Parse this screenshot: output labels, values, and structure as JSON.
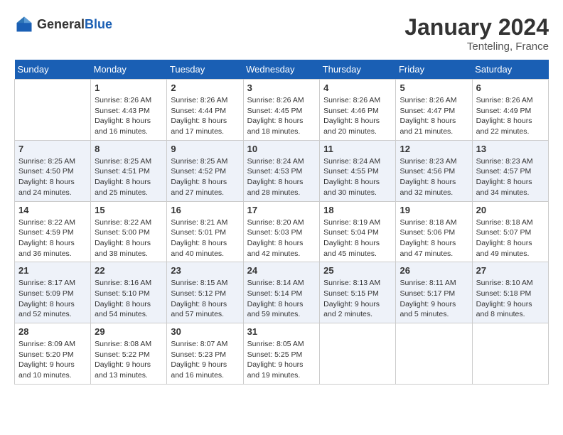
{
  "header": {
    "logo_general": "General",
    "logo_blue": "Blue",
    "month": "January 2024",
    "location": "Tenteling, France"
  },
  "weekdays": [
    "Sunday",
    "Monday",
    "Tuesday",
    "Wednesday",
    "Thursday",
    "Friday",
    "Saturday"
  ],
  "weeks": [
    [
      {
        "day": "",
        "info": ""
      },
      {
        "day": "1",
        "info": "Sunrise: 8:26 AM\nSunset: 4:43 PM\nDaylight: 8 hours\nand 16 minutes."
      },
      {
        "day": "2",
        "info": "Sunrise: 8:26 AM\nSunset: 4:44 PM\nDaylight: 8 hours\nand 17 minutes."
      },
      {
        "day": "3",
        "info": "Sunrise: 8:26 AM\nSunset: 4:45 PM\nDaylight: 8 hours\nand 18 minutes."
      },
      {
        "day": "4",
        "info": "Sunrise: 8:26 AM\nSunset: 4:46 PM\nDaylight: 8 hours\nand 20 minutes."
      },
      {
        "day": "5",
        "info": "Sunrise: 8:26 AM\nSunset: 4:47 PM\nDaylight: 8 hours\nand 21 minutes."
      },
      {
        "day": "6",
        "info": "Sunrise: 8:26 AM\nSunset: 4:49 PM\nDaylight: 8 hours\nand 22 minutes."
      }
    ],
    [
      {
        "day": "7",
        "info": "Sunrise: 8:25 AM\nSunset: 4:50 PM\nDaylight: 8 hours\nand 24 minutes."
      },
      {
        "day": "8",
        "info": "Sunrise: 8:25 AM\nSunset: 4:51 PM\nDaylight: 8 hours\nand 25 minutes."
      },
      {
        "day": "9",
        "info": "Sunrise: 8:25 AM\nSunset: 4:52 PM\nDaylight: 8 hours\nand 27 minutes."
      },
      {
        "day": "10",
        "info": "Sunrise: 8:24 AM\nSunset: 4:53 PM\nDaylight: 8 hours\nand 28 minutes."
      },
      {
        "day": "11",
        "info": "Sunrise: 8:24 AM\nSunset: 4:55 PM\nDaylight: 8 hours\nand 30 minutes."
      },
      {
        "day": "12",
        "info": "Sunrise: 8:23 AM\nSunset: 4:56 PM\nDaylight: 8 hours\nand 32 minutes."
      },
      {
        "day": "13",
        "info": "Sunrise: 8:23 AM\nSunset: 4:57 PM\nDaylight: 8 hours\nand 34 minutes."
      }
    ],
    [
      {
        "day": "14",
        "info": "Sunrise: 8:22 AM\nSunset: 4:59 PM\nDaylight: 8 hours\nand 36 minutes."
      },
      {
        "day": "15",
        "info": "Sunrise: 8:22 AM\nSunset: 5:00 PM\nDaylight: 8 hours\nand 38 minutes."
      },
      {
        "day": "16",
        "info": "Sunrise: 8:21 AM\nSunset: 5:01 PM\nDaylight: 8 hours\nand 40 minutes."
      },
      {
        "day": "17",
        "info": "Sunrise: 8:20 AM\nSunset: 5:03 PM\nDaylight: 8 hours\nand 42 minutes."
      },
      {
        "day": "18",
        "info": "Sunrise: 8:19 AM\nSunset: 5:04 PM\nDaylight: 8 hours\nand 45 minutes."
      },
      {
        "day": "19",
        "info": "Sunrise: 8:18 AM\nSunset: 5:06 PM\nDaylight: 8 hours\nand 47 minutes."
      },
      {
        "day": "20",
        "info": "Sunrise: 8:18 AM\nSunset: 5:07 PM\nDaylight: 8 hours\nand 49 minutes."
      }
    ],
    [
      {
        "day": "21",
        "info": "Sunrise: 8:17 AM\nSunset: 5:09 PM\nDaylight: 8 hours\nand 52 minutes."
      },
      {
        "day": "22",
        "info": "Sunrise: 8:16 AM\nSunset: 5:10 PM\nDaylight: 8 hours\nand 54 minutes."
      },
      {
        "day": "23",
        "info": "Sunrise: 8:15 AM\nSunset: 5:12 PM\nDaylight: 8 hours\nand 57 minutes."
      },
      {
        "day": "24",
        "info": "Sunrise: 8:14 AM\nSunset: 5:14 PM\nDaylight: 8 hours\nand 59 minutes."
      },
      {
        "day": "25",
        "info": "Sunrise: 8:13 AM\nSunset: 5:15 PM\nDaylight: 9 hours\nand 2 minutes."
      },
      {
        "day": "26",
        "info": "Sunrise: 8:11 AM\nSunset: 5:17 PM\nDaylight: 9 hours\nand 5 minutes."
      },
      {
        "day": "27",
        "info": "Sunrise: 8:10 AM\nSunset: 5:18 PM\nDaylight: 9 hours\nand 8 minutes."
      }
    ],
    [
      {
        "day": "28",
        "info": "Sunrise: 8:09 AM\nSunset: 5:20 PM\nDaylight: 9 hours\nand 10 minutes."
      },
      {
        "day": "29",
        "info": "Sunrise: 8:08 AM\nSunset: 5:22 PM\nDaylight: 9 hours\nand 13 minutes."
      },
      {
        "day": "30",
        "info": "Sunrise: 8:07 AM\nSunset: 5:23 PM\nDaylight: 9 hours\nand 16 minutes."
      },
      {
        "day": "31",
        "info": "Sunrise: 8:05 AM\nSunset: 5:25 PM\nDaylight: 9 hours\nand 19 minutes."
      },
      {
        "day": "",
        "info": ""
      },
      {
        "day": "",
        "info": ""
      },
      {
        "day": "",
        "info": ""
      }
    ]
  ]
}
